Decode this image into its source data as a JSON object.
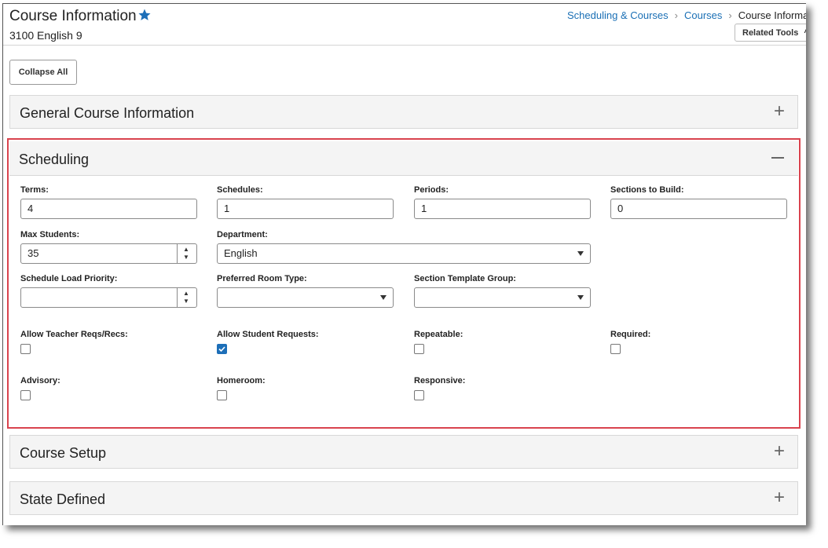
{
  "header": {
    "title": "Course Information",
    "subtitle": "3100 English 9",
    "breadcrumb": [
      "Scheduling & Courses",
      "Courses",
      "Course Informati"
    ],
    "related_tools": "Related Tools"
  },
  "toolbar": {
    "collapse_all": "Collapse All"
  },
  "sections": {
    "general": "General Course Information",
    "scheduling": "Scheduling",
    "course_setup": "Course Setup",
    "state_defined": "State Defined"
  },
  "scheduling": {
    "terms": {
      "label": "Terms:",
      "value": "4"
    },
    "schedules": {
      "label": "Schedules:",
      "value": "1"
    },
    "periods": {
      "label": "Periods:",
      "value": "1"
    },
    "sections_to_build": {
      "label": "Sections to Build:",
      "value": "0"
    },
    "max_students": {
      "label": "Max Students:",
      "value": "35"
    },
    "department": {
      "label": "Department:",
      "value": "English"
    },
    "schedule_load_priority": {
      "label": "Schedule Load Priority:",
      "value": ""
    },
    "preferred_room_type": {
      "label": "Preferred Room Type:",
      "value": ""
    },
    "section_template_group": {
      "label": "Section Template Group:",
      "value": ""
    },
    "allow_teacher_reqs": {
      "label": "Allow Teacher Reqs/Recs:",
      "checked": false
    },
    "allow_student_requests": {
      "label": "Allow Student Requests:",
      "checked": true
    },
    "repeatable": {
      "label": "Repeatable:",
      "checked": false
    },
    "required": {
      "label": "Required:",
      "checked": false
    },
    "advisory": {
      "label": "Advisory:",
      "checked": false
    },
    "homeroom": {
      "label": "Homeroom:",
      "checked": false
    },
    "responsive": {
      "label": "Responsive:",
      "checked": false
    }
  },
  "colors": {
    "accent": "#1d6fb8",
    "link": "#1a6fb5",
    "highlight": "#d9434e"
  }
}
